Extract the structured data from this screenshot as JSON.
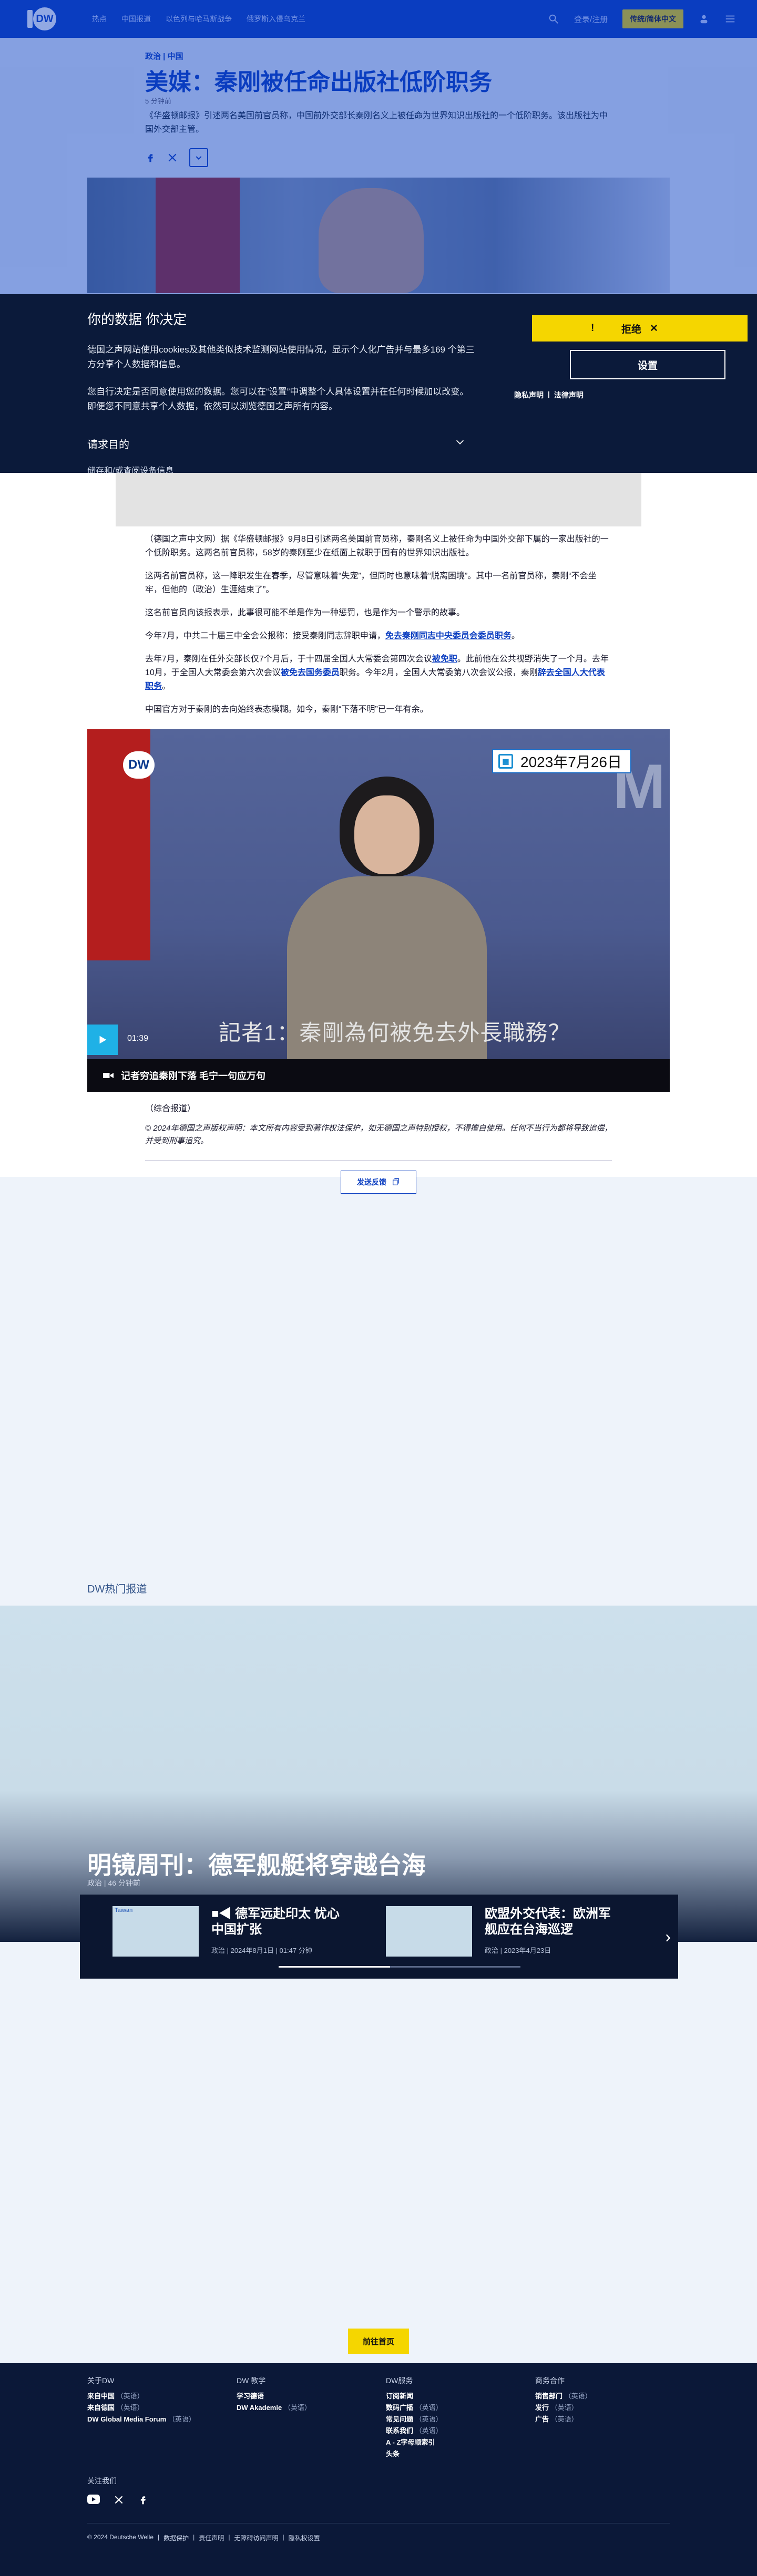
{
  "header": {
    "logo_text": "DW",
    "nav": [
      "热点",
      "中国报道",
      "以色列与哈马斯战争",
      "俄罗斯入侵乌克兰"
    ],
    "login": "登录/注册",
    "lang_button": "传统/简体中文"
  },
  "article": {
    "kicker": "政治 | 中国",
    "title": "美媒：秦刚被任命出版社低阶职务",
    "date": "5 分钟前",
    "teaser": "《华盛顿邮报》引述两名美国前官员称，中国前外交部长秦刚名义上被任命为世界知识出版社的一个低阶职务。该出版社为中国外交部主管。",
    "paragraphs": [
      "（德国之声中文网）据《华盛顿邮报》9月8日引述两名美国前官员称，秦刚名义上被任命为中国外交部下属的一家出版社的一个低阶职务。这两名前官员称，58岁的秦刚至少在纸面上就职于国有的世界知识出版社。",
      "这两名前官员称，这一降职发生在春季，尽管意味着“失宠”，但同时也意味着“脱离困境”。其中一名前官员称，秦刚“不会坐牢，但他的（政治）生涯结束了”。",
      "这名前官员向该报表示，此事很可能不单是作为一种惩罚，也是作为一个警示的故事。",
      "今年7月，中共二十届三中全会公报称：接受秦刚同志辞职申请，",
      "去年7月，秦刚在任外交部长仅7个月后，于十四届全国人大常委会第四次会议",
      "中国官方对于秦刚的去向始终表态模糊。如今，秦刚“下落不明”已一年有余。"
    ],
    "link1": "免去秦刚同志中央委员会委员职务",
    "p5_mid": "。此前他在公共视野消失了一个月。去年10月，于全国人大常委会第六次会议",
    "link2": "被免职",
    "link3": "被免去国务委员",
    "p5_end": "职务。今年2月，全国人大常委第八次会议公报，秦刚",
    "link4": "辞去全国人大代表职务",
    "source": "（综合报道）",
    "copyright": "© 2024年德国之声版权声明：本文所有内容受到著作权法保护，如无德国之声特别授权，不得擅自使用。任何不当行为都将导致追偿，并受到刑事追究。",
    "feedback": "发送反馈"
  },
  "cookie": {
    "title": "你的数据 你决定",
    "text1": "德国之声网站使用cookies及其他类似技术监测网站使用情况，显示个人化广告并与最多169 个第三方分享个人数据和信息。",
    "text2": "您自行决定是否同意使用您的数据。您可以在“设置”中调整个人具体设置并在任何时候加以改变。即便您不同意共享个人数据，依然可以浏览德国之声所有内容。",
    "purpose": "请求目的",
    "cut": "储存和/或查阅设备信息",
    "reject": "拒绝",
    "settings": "设置",
    "privacy": "隐私声明",
    "legal": "法律声明"
  },
  "video": {
    "date_badge": "2023年7月26日",
    "subtitle": "記者1：秦剛為何被免去外長職務？",
    "time": "01:39",
    "caption": "记者穷追秦刚下落 毛宁一句应万句"
  },
  "hot": {
    "label": "DW热门报道",
    "title": "明镜周刊：德军舰艇将穿越台海",
    "meta": "政治 | 46 分钟前",
    "cards": [
      {
        "thumb_alt": "Taiwan",
        "title": "德军远赴印太 忧心中国扩张",
        "meta": "政治 | 2024年8月1日 | 01:47 分钟"
      },
      {
        "thumb_alt": "",
        "title": "欧盟外交代表：欧洲军舰应在台海巡逻",
        "meta": "政治 | 2023年4月23日"
      }
    ],
    "progress": 0.46
  },
  "home_button": "前往首页",
  "footer": {
    "cols": [
      {
        "head": "关于DW",
        "items": [
          [
            "来自中国",
            "（英语）"
          ],
          [
            "来自德国",
            "（英语）"
          ],
          [
            "DW Global Media Forum",
            "（英语）"
          ]
        ]
      },
      {
        "head": "DW 教学",
        "items": [
          [
            "学习德语",
            ""
          ],
          [
            "DW Akademie",
            "（英语）"
          ]
        ]
      },
      {
        "head": "DW服务",
        "items": [
          [
            "订阅新闻",
            ""
          ],
          [
            "数码广播",
            "（英语）"
          ],
          [
            "常见问题",
            "（英语）"
          ],
          [
            "联系我们",
            "（英语）"
          ],
          [
            "A - Z字母顺索引",
            ""
          ],
          [
            "头条",
            ""
          ]
        ]
      },
      {
        "head": "商务合作",
        "items": [
          [
            "销售部门",
            "（英语）"
          ],
          [
            "发行",
            "（英语）"
          ],
          [
            "广告",
            "（英语）"
          ]
        ]
      }
    ],
    "follow": "关注我们",
    "bottom": [
      "© 2024 Deutsche Welle",
      "数据保护",
      "责任声明",
      "无障碍访问声明",
      "隐私权设置"
    ]
  }
}
